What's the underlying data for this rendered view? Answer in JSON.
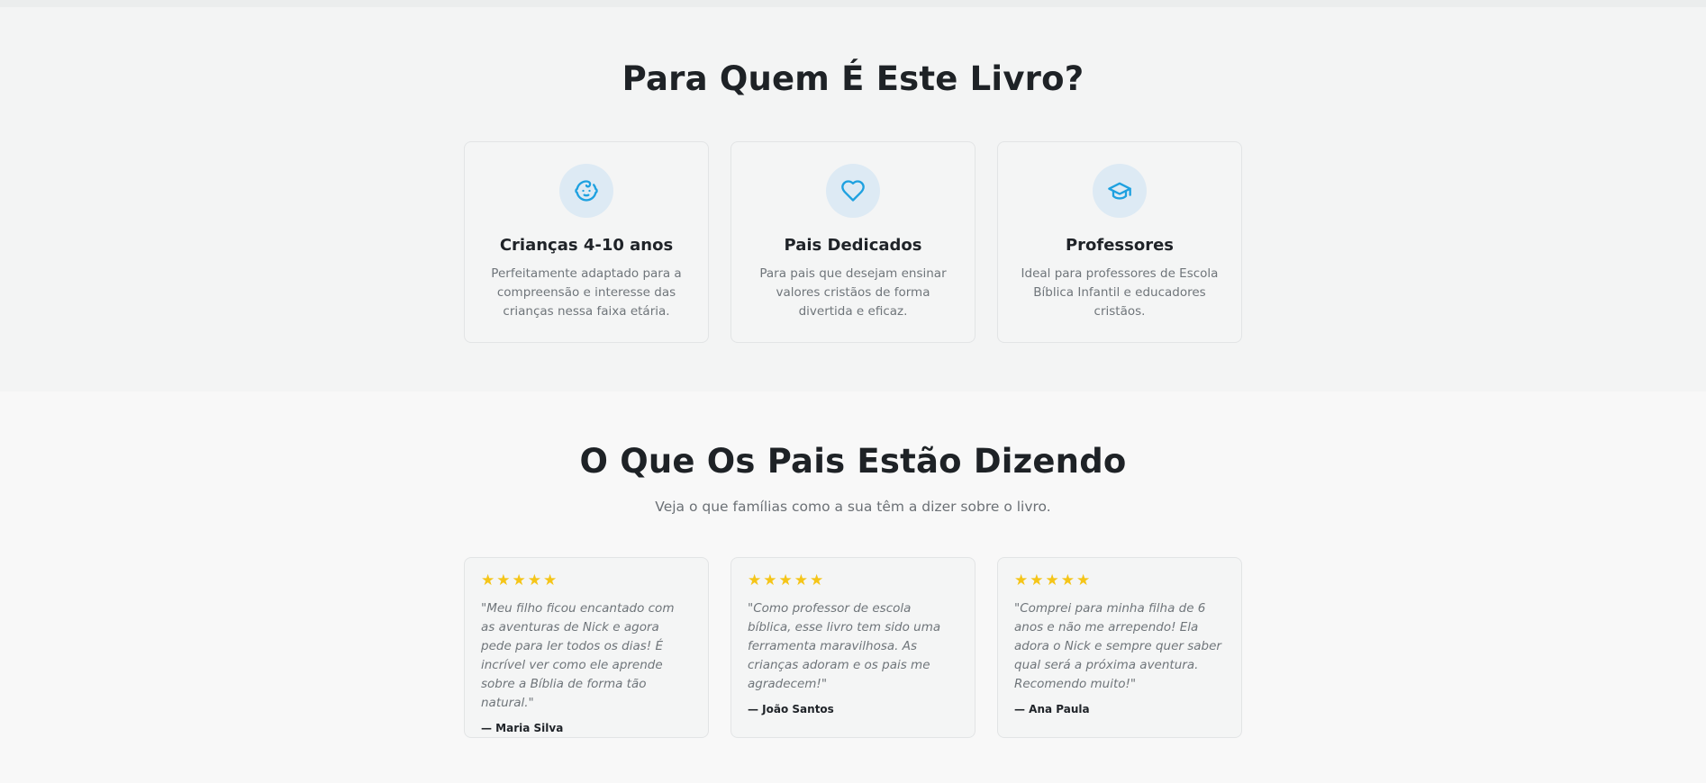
{
  "audience": {
    "title": "Para Quem É Este Livro?",
    "cards": [
      {
        "icon": "baby-face-icon",
        "title": "Crianças 4-10 anos",
        "text": "Perfeitamente adaptado para a compreensão e interesse das crianças nessa faixa etária."
      },
      {
        "icon": "heart-icon",
        "title": "Pais Dedicados",
        "text": "Para pais que desejam ensinar valores cristãos de forma divertida e eficaz."
      },
      {
        "icon": "graduation-cap-icon",
        "title": "Professores",
        "text": "Ideal para professores de Escola Bíblica Infantil e educadores cristãos."
      }
    ]
  },
  "testimonials": {
    "title": "O Que Os Pais Estão Dizendo",
    "subtitle": "Veja o que famílias como a sua têm a dizer sobre o livro.",
    "items": [
      {
        "rating": 5,
        "quote": "\"Meu filho ficou encantado com as aventuras de Nick e agora pede para ler todos os dias! É incrível ver como ele aprende sobre a Bíblia de forma tão natural.\"",
        "author": "— Maria Silva"
      },
      {
        "rating": 5,
        "quote": "\"Como professor de escola bíblica, esse livro tem sido uma ferramenta maravilhosa. As crianças adoram e os pais me agradecem!\"",
        "author": "— João Santos"
      },
      {
        "rating": 5,
        "quote": "\"Comprei para minha filha de 6 anos e não me arrependo! Ela adora o Nick e sempre quer saber qual será a próxima aventura. Recomendo muito!\"",
        "author": "— Ana Paula"
      }
    ]
  },
  "colors": {
    "accent": "#1ea1e0",
    "star": "#f5c518",
    "icon_bg": "#ddeaf4"
  }
}
